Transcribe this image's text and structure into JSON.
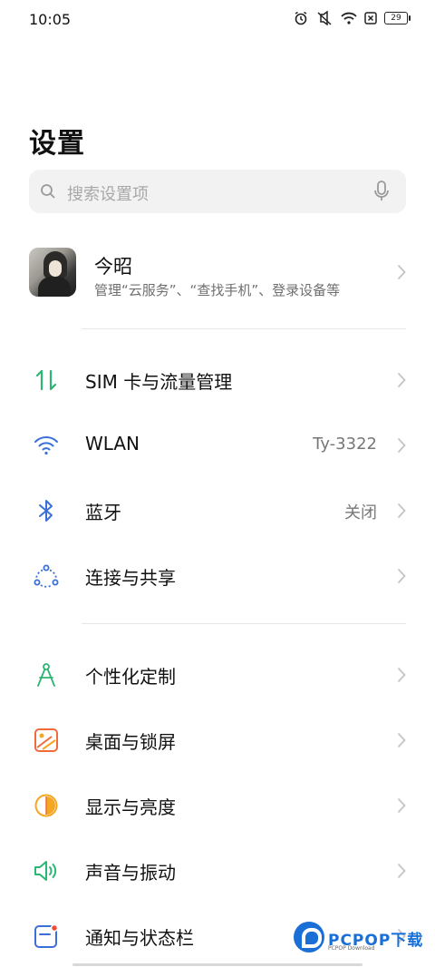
{
  "status_bar": {
    "time": "10:05",
    "battery": "29",
    "icons": [
      "alarm-icon",
      "mute-icon",
      "wifi-icon",
      "no-sim-icon",
      "battery-icon"
    ]
  },
  "page_title": "设置",
  "search": {
    "placeholder": "搜索设置项",
    "icon": "search-icon",
    "mic_icon": "microphone-icon"
  },
  "account": {
    "name": "今昭",
    "description": "管理“云服务”、“查找手机”、登录设备等"
  },
  "groups": [
    {
      "items": [
        {
          "label": "SIM 卡与流量管理",
          "value": "",
          "icon": "sim-data-icon",
          "color": "#2bb673"
        },
        {
          "label": "WLAN",
          "value": "Ty-3322",
          "icon": "wifi-icon",
          "color": "#3a6fd8"
        },
        {
          "label": "蓝牙",
          "value": "关闭",
          "icon": "bluetooth-icon",
          "color": "#3a6fd8"
        },
        {
          "label": "连接与共享",
          "value": "",
          "icon": "share-icon",
          "color": "#3a6fd8"
        }
      ]
    },
    {
      "items": [
        {
          "label": "个性化定制",
          "value": "",
          "icon": "compass-icon",
          "color": "#2bb673"
        },
        {
          "label": "桌面与锁屏",
          "value": "",
          "icon": "wallpaper-icon",
          "color": "#f06b3c"
        },
        {
          "label": "显示与亮度",
          "value": "",
          "icon": "brightness-icon",
          "color": "#f5a623"
        },
        {
          "label": "声音与振动",
          "value": "",
          "icon": "speaker-icon",
          "color": "#2bb673"
        },
        {
          "label": "通知与状态栏",
          "value": "",
          "icon": "notification-icon",
          "color": "#3a6fd8"
        }
      ]
    }
  ],
  "watermark": {
    "text": "PCPOP下载",
    "sub": "PCPOP Download"
  }
}
